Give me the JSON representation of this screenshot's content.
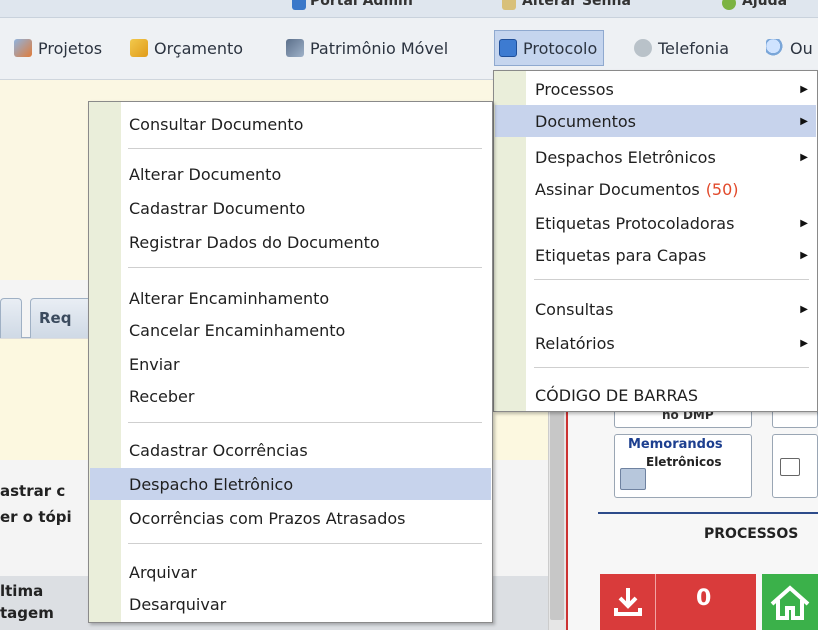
{
  "menubar": {
    "items": [
      {
        "label": "Projetos",
        "icon": "projects-icon"
      },
      {
        "label": "Orçamento",
        "icon": "budget-icon"
      },
      {
        "label": "Patrimônio Móvel",
        "icon": "assets-icon"
      },
      {
        "label": "Protocolo",
        "icon": "protocol-icon"
      },
      {
        "label": "Telefonia",
        "icon": "phone-icon"
      },
      {
        "label": "Ou",
        "icon": "search-icon"
      }
    ]
  },
  "topstrip": {
    "portal": "Portal Admin",
    "alterar_senha": "Alterar Senha",
    "ajuda": "Ajuda"
  },
  "background": {
    "tab_partial": "Req",
    "line1": "astrar c",
    "line2": "er o tópi",
    "line3": "ltima",
    "line4": "tagem"
  },
  "right_panel": {
    "dmp_label": "no DMP",
    "memo_line1": "Memorandos",
    "memo_line2": "Eletrônicos",
    "processos_title": "PROCESSOS",
    "counter": "0"
  },
  "protocolo_menu": {
    "items": [
      {
        "label": "Processos",
        "submenu": true
      },
      {
        "label": "Documentos",
        "submenu": true,
        "highlighted": true
      },
      {
        "label": "Despachos Eletrônicos",
        "submenu": true
      },
      {
        "label": "Assinar Documentos",
        "count": "(50)",
        "submenu": false
      },
      {
        "label": "Etiquetas Protocoladoras",
        "submenu": true
      },
      {
        "label": "Etiquetas para Capas",
        "submenu": true
      },
      {
        "label": "Consultas",
        "submenu": true
      },
      {
        "label": "Relatórios",
        "submenu": true
      },
      {
        "label": "CÓDIGO DE BARRAS",
        "submenu": false
      }
    ]
  },
  "documentos_menu": {
    "items": [
      {
        "label": "Consultar Documento"
      },
      {
        "label": "Alterar Documento"
      },
      {
        "label": "Cadastrar Documento"
      },
      {
        "label": "Registrar Dados do Documento"
      },
      {
        "label": "Alterar Encaminhamento"
      },
      {
        "label": "Cancelar Encaminhamento"
      },
      {
        "label": "Enviar"
      },
      {
        "label": "Receber"
      },
      {
        "label": "Cadastrar Ocorrências"
      },
      {
        "label": "Despacho Eletrônico",
        "highlighted": true
      },
      {
        "label": "Ocorrências com Prazos Atrasados"
      },
      {
        "label": "Arquivar"
      },
      {
        "label": "Desarquivar"
      }
    ]
  },
  "colors": {
    "highlight": "#c7d3ec",
    "gutter": "#eaeeda",
    "count_red": "#e24a2b",
    "menubar_active": "#c5d5ee"
  }
}
